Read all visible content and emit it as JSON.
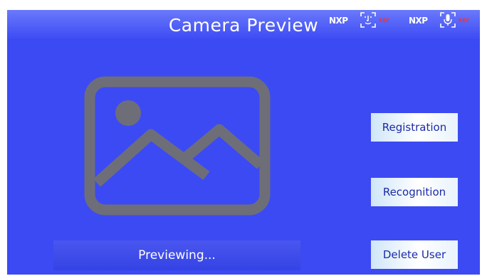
{
  "header": {
    "title": "Camera Preview"
  },
  "badges": [
    {
      "brand": "NXP",
      "icon": "face-scan-icon",
      "tag": "REC"
    },
    {
      "brand": "NXP",
      "icon": "microphone-icon",
      "tag": "REC"
    }
  ],
  "preview": {
    "icon": "image-placeholder-icon"
  },
  "buttons": {
    "registration": "Registration",
    "recognition": "Recognition",
    "delete_user": "Delete User"
  },
  "status": {
    "text": "Previewing..."
  },
  "colors": {
    "background": "#3c4af4",
    "icon_gray": "#6e6e78",
    "button_text": "#1b2aa6",
    "rec_red": "#ff2d2d"
  }
}
